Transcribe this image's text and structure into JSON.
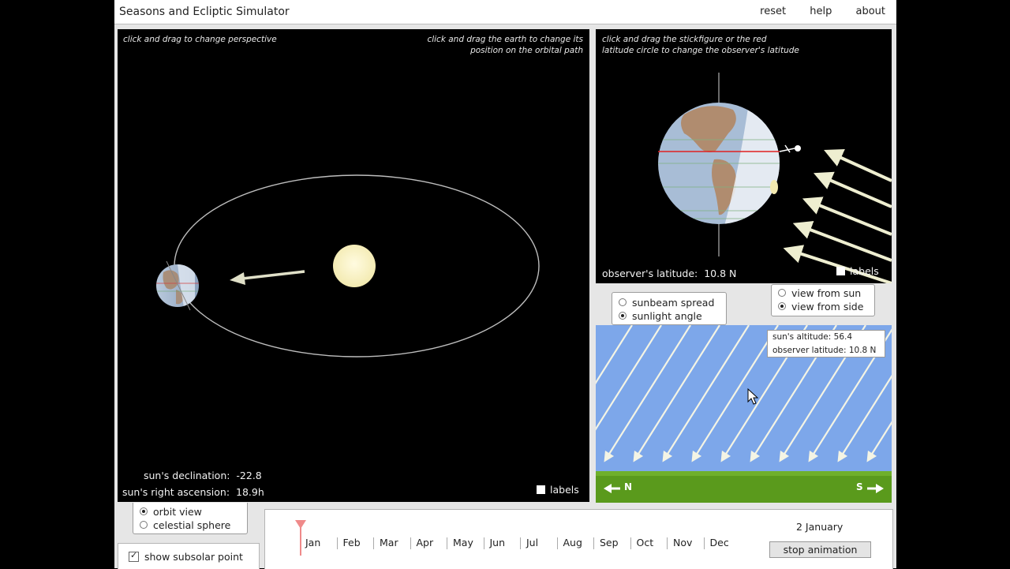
{
  "app": {
    "title": "Seasons and Ecliptic Simulator",
    "menu": {
      "reset": "reset",
      "help": "help",
      "about": "about"
    }
  },
  "orbit_panel": {
    "hint_left": "click and drag to change perspective",
    "hint_right_line1": "click and drag the earth to change its",
    "hint_right_line2": "position on the orbital path",
    "declination_label": "sun's declination:",
    "declination_value": "-22.8",
    "ra_label": "sun's right ascension:",
    "ra_value": "18.9h",
    "labels_checkbox": "labels",
    "colors": {
      "orbit": "#bdbdbd",
      "sun": "#fff6c2",
      "arrow": "#e0e0c8"
    }
  },
  "earth_panel": {
    "hint_line1": "click and drag the stickfigure or the red",
    "hint_line2": "latitude circle to change the observer's latitude",
    "latitude_label": "observer's latitude:",
    "latitude_value": "10.8 N",
    "labels_checkbox": "labels",
    "colors": {
      "latitude_circle": "#e02020",
      "sunbeam": "#eeeed0"
    }
  },
  "beam_mode": {
    "options": [
      {
        "label": "sunbeam spread",
        "selected": false
      },
      {
        "label": "sunlight angle",
        "selected": true
      }
    ]
  },
  "view_mode": {
    "options": [
      {
        "label": "view from sun",
        "selected": false
      },
      {
        "label": "view from side",
        "selected": true
      }
    ]
  },
  "sunlight_panel": {
    "altitude_label": "sun's altitude:",
    "altitude_value": "56.4",
    "latitude_label": "observer latitude:",
    "latitude_value": "10.8 N",
    "north_label": "N",
    "south_label": "S",
    "colors": {
      "sky": "#7da7ea",
      "ground": "#5a9a1c"
    }
  },
  "view_toggle": {
    "options": [
      {
        "label": "orbit view",
        "selected": true
      },
      {
        "label": "celestial sphere",
        "selected": false
      }
    ]
  },
  "subsolar": {
    "label": "show subsolar point",
    "checked": true
  },
  "timeline": {
    "months": [
      "Jan",
      "Feb",
      "Mar",
      "Apr",
      "May",
      "Jun",
      "Jul",
      "Aug",
      "Sep",
      "Oct",
      "Nov",
      "Dec"
    ],
    "date": "2 January",
    "button": "stop animation",
    "year_fraction": 0.005,
    "colors": {
      "marker": "#ef8a8a"
    }
  }
}
